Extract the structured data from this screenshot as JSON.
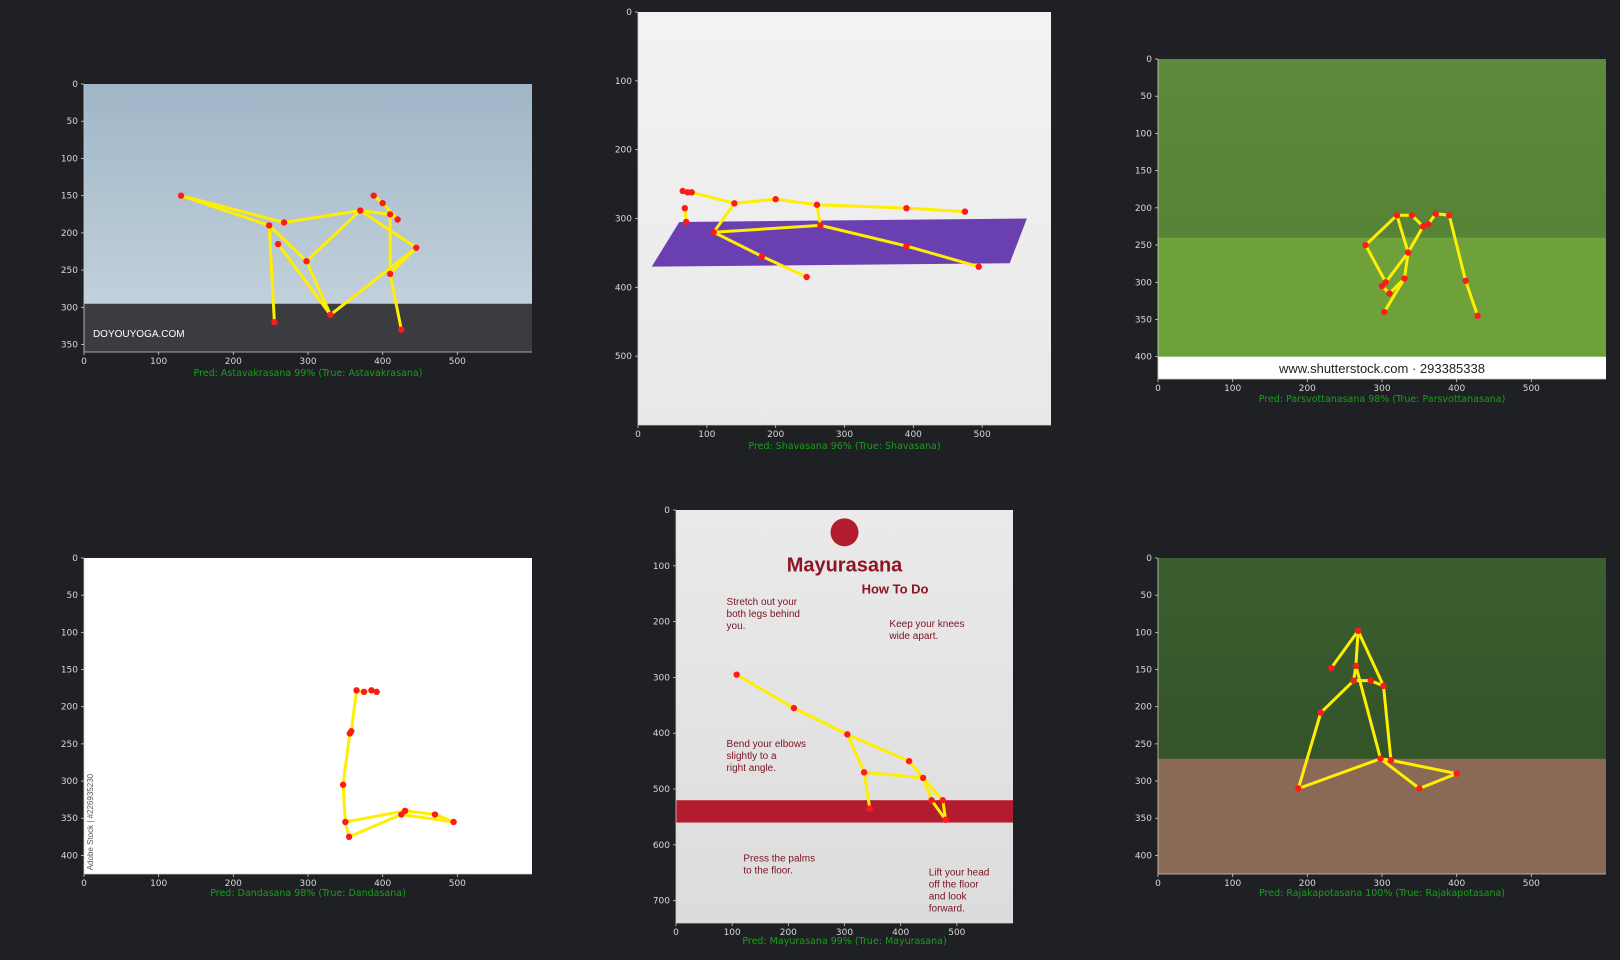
{
  "colors": {
    "background": "#1e2023",
    "axis": "#cfcfcf",
    "tick_text": "#d8d8d8",
    "caption": "#18a018",
    "skeleton_line": "#ffee00",
    "keypoint": "#ff1a1a"
  },
  "panels": [
    {
      "id": "astavakrasana",
      "caption": "Pred: Astavakrasana 99% (True: Astavakrasana)",
      "xticks": [
        "0",
        "100",
        "200",
        "300",
        "400",
        "500"
      ],
      "yticks": [
        "0",
        "50",
        "100",
        "150",
        "200",
        "250",
        "300",
        "350"
      ],
      "xlim": [
        0,
        600
      ],
      "ylim": [
        0,
        360
      ],
      "image_text": "DOYOUYOGA.COM",
      "skeleton_points": [
        [
          130,
          150
        ],
        [
          248,
          190
        ],
        [
          268,
          186
        ],
        [
          370,
          170
        ],
        [
          410,
          175
        ],
        [
          420,
          182
        ],
        [
          445,
          220
        ],
        [
          330,
          310
        ],
        [
          255,
          320
        ],
        [
          298,
          238
        ],
        [
          260,
          215
        ],
        [
          410,
          255
        ],
        [
          425,
          330
        ],
        [
          388,
          150
        ],
        [
          400,
          160
        ]
      ],
      "skeleton_edges": [
        [
          0,
          1
        ],
        [
          0,
          2
        ],
        [
          1,
          8
        ],
        [
          1,
          9
        ],
        [
          2,
          3
        ],
        [
          3,
          4
        ],
        [
          4,
          5
        ],
        [
          3,
          6
        ],
        [
          6,
          7
        ],
        [
          9,
          7
        ],
        [
          10,
          7
        ],
        [
          3,
          9
        ],
        [
          4,
          11
        ],
        [
          11,
          12
        ],
        [
          6,
          11
        ],
        [
          13,
          14
        ],
        [
          14,
          5
        ]
      ]
    },
    {
      "id": "shavasana",
      "caption": "Pred: Shavasana 96% (True: Shavasana)",
      "xticks": [
        "0",
        "100",
        "200",
        "300",
        "400",
        "500"
      ],
      "yticks": [
        "0",
        "100",
        "200",
        "300",
        "400",
        "500"
      ],
      "xlim": [
        0,
        600
      ],
      "ylim": [
        0,
        600
      ],
      "image_text": "",
      "skeleton_points": [
        [
          65,
          260
        ],
        [
          72,
          262
        ],
        [
          68,
          285
        ],
        [
          70,
          305
        ],
        [
          78,
          262
        ],
        [
          140,
          278
        ],
        [
          200,
          272
        ],
        [
          260,
          280
        ],
        [
          265,
          310
        ],
        [
          110,
          320
        ],
        [
          180,
          355
        ],
        [
          245,
          385
        ],
        [
          390,
          285
        ],
        [
          475,
          290
        ],
        [
          390,
          340
        ],
        [
          495,
          370
        ]
      ],
      "skeleton_edges": [
        [
          0,
          1
        ],
        [
          1,
          4
        ],
        [
          4,
          5
        ],
        [
          2,
          3
        ],
        [
          5,
          6
        ],
        [
          6,
          7
        ],
        [
          7,
          8
        ],
        [
          5,
          9
        ],
        [
          9,
          8
        ],
        [
          9,
          10
        ],
        [
          10,
          11
        ],
        [
          7,
          12
        ],
        [
          12,
          13
        ],
        [
          8,
          14
        ],
        [
          14,
          15
        ]
      ]
    },
    {
      "id": "parsvottanasana",
      "caption": "Pred: Parsvottanasana 98% (True: Parsvottanasana)",
      "xticks": [
        "0",
        "100",
        "200",
        "300",
        "400",
        "500"
      ],
      "yticks": [
        "0",
        "50",
        "100",
        "150",
        "200",
        "250",
        "300",
        "350",
        "400"
      ],
      "xlim": [
        0,
        600
      ],
      "ylim": [
        0,
        430
      ],
      "image_text": "www.shutterstock.com · 293385338",
      "skeleton_points": [
        [
          278,
          250
        ],
        [
          305,
          300
        ],
        [
          300,
          305
        ],
        [
          310,
          315
        ],
        [
          330,
          295
        ],
        [
          320,
          210
        ],
        [
          340,
          210
        ],
        [
          355,
          225
        ],
        [
          362,
          222
        ],
        [
          372,
          208
        ],
        [
          390,
          210
        ],
        [
          412,
          298
        ],
        [
          428,
          345
        ],
        [
          303,
          340
        ],
        [
          335,
          260
        ]
      ],
      "skeleton_edges": [
        [
          0,
          5
        ],
        [
          0,
          1
        ],
        [
          1,
          2
        ],
        [
          2,
          3
        ],
        [
          3,
          4
        ],
        [
          5,
          6
        ],
        [
          6,
          7
        ],
        [
          7,
          8
        ],
        [
          8,
          9
        ],
        [
          9,
          10
        ],
        [
          10,
          11
        ],
        [
          11,
          12
        ],
        [
          4,
          13
        ],
        [
          5,
          14
        ],
        [
          14,
          4
        ],
        [
          7,
          14
        ],
        [
          14,
          1
        ]
      ]
    },
    {
      "id": "dandasana",
      "caption": "Pred: Dandasana 98% (True: Dandasana)",
      "xticks": [
        "0",
        "100",
        "200",
        "300",
        "400",
        "500"
      ],
      "yticks": [
        "0",
        "50",
        "100",
        "150",
        "200",
        "250",
        "300",
        "350",
        "400"
      ],
      "xlim": [
        0,
        600
      ],
      "ylim": [
        0,
        425
      ],
      "image_text": "Adobe Stock | #226935230",
      "skeleton_points": [
        [
          365,
          178
        ],
        [
          375,
          180
        ],
        [
          385,
          178
        ],
        [
          392,
          180
        ],
        [
          358,
          233
        ],
        [
          356,
          236
        ],
        [
          347,
          305
        ],
        [
          350,
          355
        ],
        [
          355,
          375
        ],
        [
          430,
          340
        ],
        [
          470,
          345
        ],
        [
          495,
          355
        ],
        [
          425,
          345
        ]
      ],
      "skeleton_edges": [
        [
          0,
          1
        ],
        [
          1,
          2
        ],
        [
          2,
          3
        ],
        [
          0,
          4
        ],
        [
          4,
          5
        ],
        [
          5,
          6
        ],
        [
          6,
          7
        ],
        [
          7,
          8
        ],
        [
          7,
          9
        ],
        [
          9,
          10
        ],
        [
          10,
          11
        ],
        [
          8,
          12
        ],
        [
          12,
          11
        ]
      ]
    },
    {
      "id": "mayurasana",
      "caption": "Pred: Mayurasana 99% (True: Mayurasana)",
      "xticks": [
        "0",
        "100",
        "200",
        "300",
        "400",
        "500"
      ],
      "yticks": [
        "0",
        "100",
        "200",
        "300",
        "400",
        "500",
        "600",
        "700"
      ],
      "xlim": [
        0,
        600
      ],
      "ylim": [
        0,
        740
      ],
      "image_text": "Mayurasana",
      "image_subtitle": "How To Do",
      "image_notes": [
        "Stretch out your both legs behind you.",
        "Keep your knees wide apart.",
        "Bend your elbows slightly to a right angle.",
        "Press the palms to the floor.",
        "Lift your head off the floor and look forward."
      ],
      "skeleton_points": [
        [
          108,
          295
        ],
        [
          210,
          355
        ],
        [
          305,
          402
        ],
        [
          335,
          470
        ],
        [
          345,
          535
        ],
        [
          415,
          450
        ],
        [
          440,
          480
        ],
        [
          475,
          520
        ],
        [
          480,
          555
        ],
        [
          455,
          520
        ]
      ],
      "skeleton_edges": [
        [
          0,
          1
        ],
        [
          1,
          2
        ],
        [
          2,
          3
        ],
        [
          3,
          4
        ],
        [
          2,
          5
        ],
        [
          5,
          6
        ],
        [
          6,
          7
        ],
        [
          7,
          8
        ],
        [
          6,
          9
        ],
        [
          9,
          8
        ],
        [
          3,
          6
        ]
      ]
    },
    {
      "id": "rajakapotasana",
      "caption": "Pred: Rajakapotasana 100% (True: Rajakapotasana)",
      "xticks": [
        "0",
        "100",
        "200",
        "300",
        "400",
        "500"
      ],
      "yticks": [
        "0",
        "50",
        "100",
        "150",
        "200",
        "250",
        "300",
        "350",
        "400"
      ],
      "xlim": [
        0,
        600
      ],
      "ylim": [
        0,
        425
      ],
      "image_text": "",
      "skeleton_points": [
        [
          232,
          148
        ],
        [
          268,
          98
        ],
        [
          265,
          145
        ],
        [
          262,
          165
        ],
        [
          285,
          165
        ],
        [
          302,
          172
        ],
        [
          218,
          208
        ],
        [
          188,
          310
        ],
        [
          298,
          270
        ],
        [
          312,
          272
        ],
        [
          400,
          290
        ],
        [
          350,
          310
        ]
      ],
      "skeleton_edges": [
        [
          0,
          1
        ],
        [
          1,
          2
        ],
        [
          2,
          3
        ],
        [
          3,
          4
        ],
        [
          4,
          5
        ],
        [
          1,
          5
        ],
        [
          5,
          9
        ],
        [
          3,
          6
        ],
        [
          6,
          7
        ],
        [
          7,
          8
        ],
        [
          8,
          9
        ],
        [
          9,
          10
        ],
        [
          10,
          11
        ],
        [
          11,
          8
        ],
        [
          2,
          8
        ]
      ]
    }
  ]
}
